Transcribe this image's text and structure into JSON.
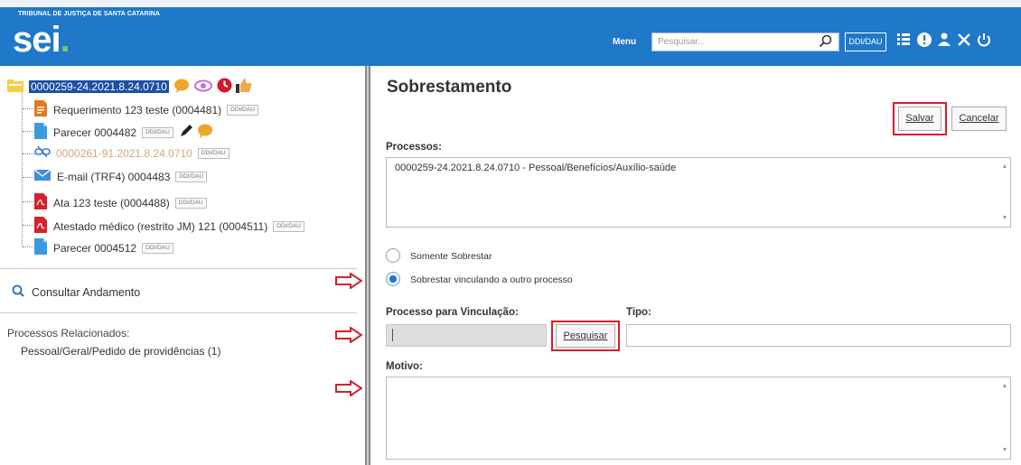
{
  "header": {
    "org_name": "TRIBUNAL DE JUSTIÇA DE SANTA CATARINA",
    "logo_text": "sei",
    "logo_dot": ".",
    "menu_label": "Menu",
    "search_placeholder": "Pesquisar...",
    "unit_label": "DDI/DAU",
    "icons": [
      "search-icon",
      "grid-icon",
      "info-icon",
      "user-icon",
      "tools-icon",
      "power-icon"
    ]
  },
  "tree": {
    "root_process": "0000259-24.2021.8.24.0710",
    "root_icons": [
      "comment-icon",
      "eye-icon",
      "clock-icon",
      "thumbs-up-icon"
    ],
    "items": [
      {
        "label": "Requerimento 123 teste (0004481)",
        "tag": "DDI/DAU",
        "icon": "form-doc-icon"
      },
      {
        "label": "Parecer 0004482",
        "tag": "DDI/DAU",
        "icon": "doc-icon"
      },
      {
        "label": "0000261-91.2021.8.24.0710",
        "tag": "DDI/DAU",
        "icon": "link-broken-icon"
      },
      {
        "label": "E-mail (TRF4) 0004483",
        "tag": "DDI/DAU",
        "icon": "email-icon"
      },
      {
        "label": "Ata 123 teste (0004488)",
        "tag": "DDI/DAU",
        "icon": "pdf-icon"
      },
      {
        "label": "Atestado médico (restrito JM) 121 (0004511)",
        "tag": "DDI/DAU",
        "icon": "pdf-icon"
      },
      {
        "label": "Parecer 0004512",
        "tag": "DDI/DAU",
        "icon": "doc-icon"
      }
    ]
  },
  "left": {
    "consultar_label": "Consultar Andamento",
    "relacionados_title": "Processos Relacionados:",
    "relacionados_item": "Pessoal/Geral/Pedido de providências (1)"
  },
  "form": {
    "title": "Sobrestamento",
    "salvar_label": "Salvar",
    "cancelar_label": "Cancelar",
    "processos_label": "Processos:",
    "processos_value": "0000259-24.2021.8.24.0710 - Pessoal/Benefícios/Auxílio-saúde",
    "radio_somente": "Somente Sobrestar",
    "radio_vinculando": "Sobrestar vinculando a outro processo",
    "selected_option": "Sobrestar vinculando a outro processo",
    "vinculacao_label": "Processo para Vinculação:",
    "vinculacao_value": "",
    "pesquisar_label": "Pesquisar",
    "tipo_label": "Tipo:",
    "tipo_value": "",
    "motivo_label": "Motivo:",
    "motivo_value": ""
  },
  "colors": {
    "header_blue": "#1f78c8",
    "highlight_red": "#d61f2c",
    "selection_blue": "#1d4fa3"
  }
}
